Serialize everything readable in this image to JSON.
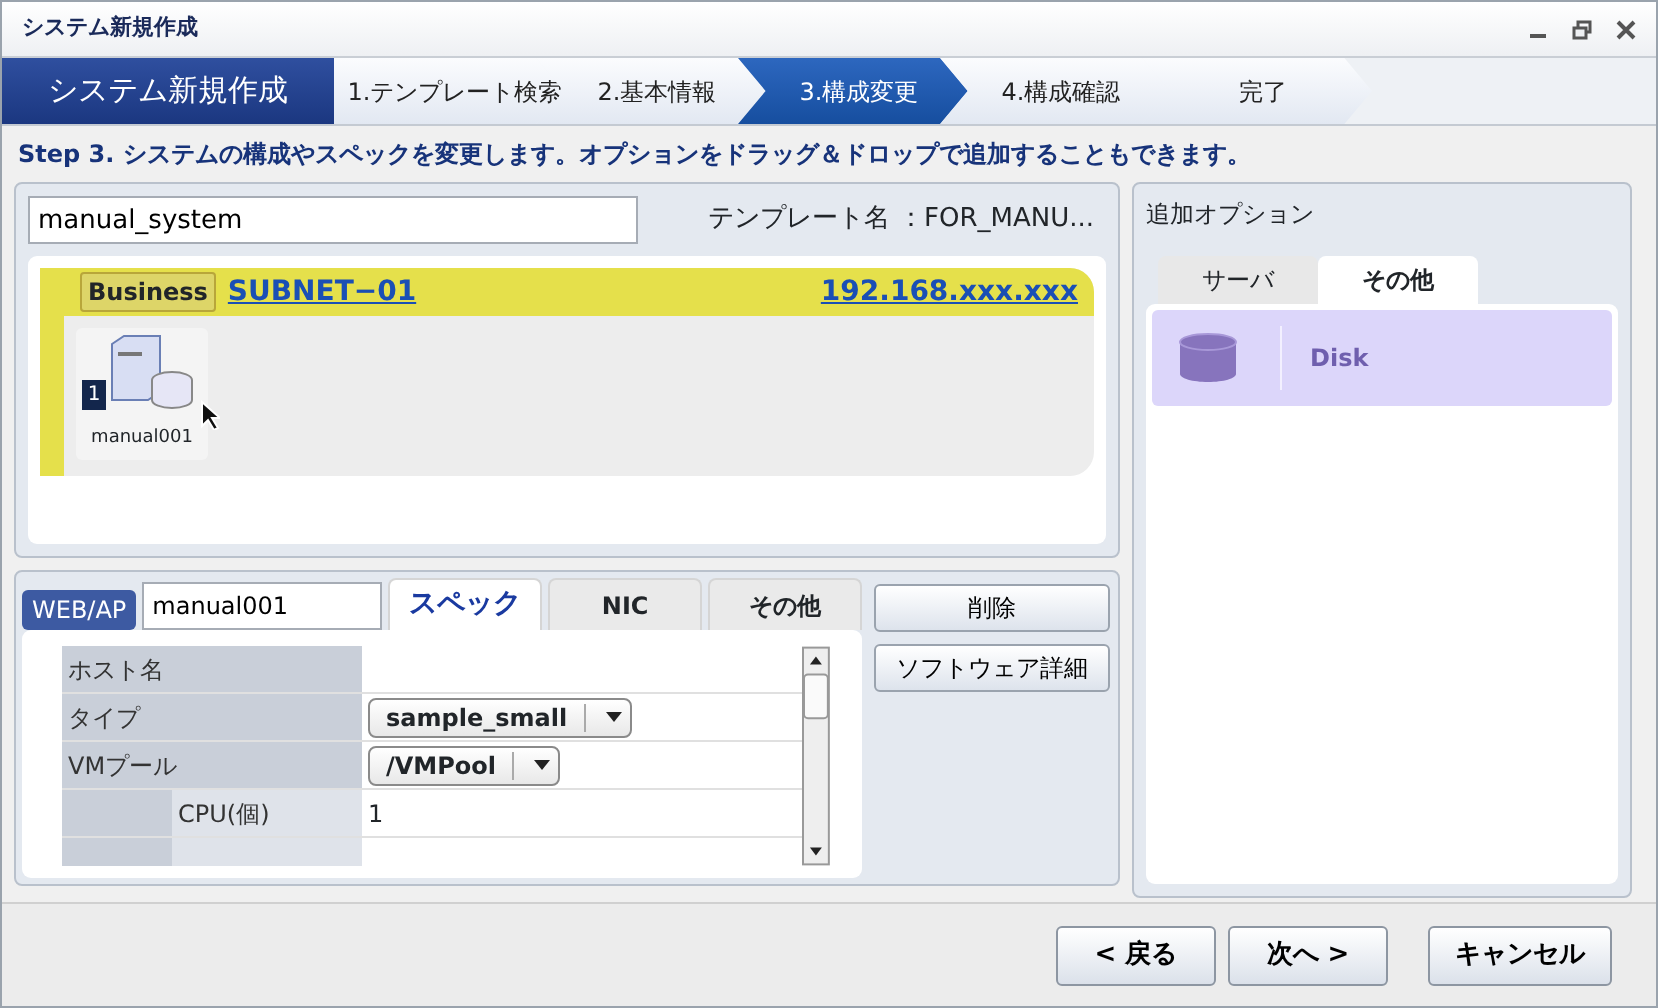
{
  "window": {
    "title": "システム新規作成"
  },
  "wizard": {
    "title": "システム新規作成",
    "steps": [
      {
        "label": "1.テンプレート検索",
        "selected": false
      },
      {
        "label": "2.基本情報",
        "selected": false
      },
      {
        "label": "3.構成変更",
        "selected": true
      },
      {
        "label": "4.構成確認",
        "selected": false
      },
      {
        "label": "完了",
        "selected": false
      }
    ]
  },
  "instruction": "Step 3. システムの構成やスペックを変更します。オプションをドラッグ＆ドロップで追加することもできます。",
  "system_name": {
    "value": "manual_system"
  },
  "template_label": "テンプレート名 ：FOR_MANU...",
  "subnet": {
    "tag": "Business",
    "name": "SUBNET−01",
    "address": "192.168.xxx.xxx",
    "servers": [
      {
        "count": "1",
        "name": "manual001"
      }
    ]
  },
  "server_editor": {
    "role": "WEB/AP",
    "name": "manual001",
    "tabs": [
      {
        "label": "スペック",
        "selected": true
      },
      {
        "label": "NIC",
        "selected": false
      },
      {
        "label": "その他",
        "selected": false
      }
    ],
    "rows": [
      {
        "kind": "text",
        "label": "ホスト名"
      },
      {
        "kind": "select",
        "label": "タイプ",
        "value": "sample_small"
      },
      {
        "kind": "select",
        "label": "VMプール",
        "value": "/VMPool"
      },
      {
        "kind": "sub",
        "label": "CPU(個)",
        "value": "1"
      }
    ],
    "buttons": [
      "削除",
      "ソフトウェア詳細"
    ]
  },
  "options": {
    "title": "追加オプション",
    "tabs": [
      {
        "label": "サーバ",
        "selected": false
      },
      {
        "label": "その他",
        "selected": true
      }
    ],
    "items": [
      {
        "label": "Disk"
      }
    ]
  },
  "footer_buttons": [
    "< 戻る",
    "次へ >",
    "キャンセル"
  ]
}
